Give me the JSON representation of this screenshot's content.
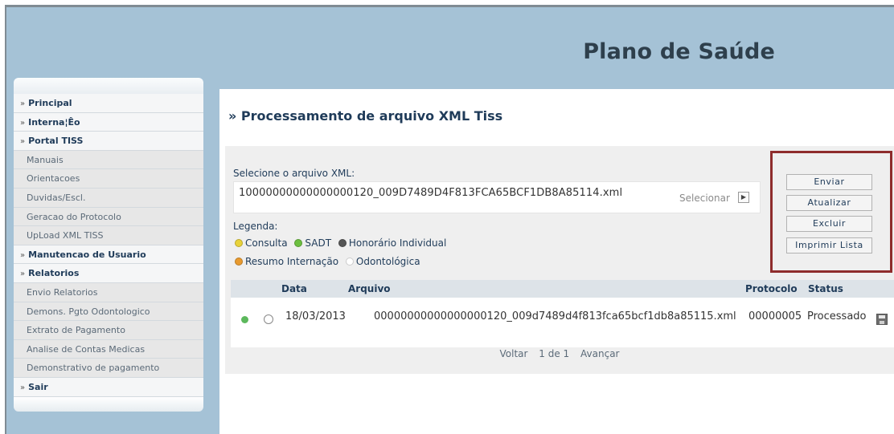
{
  "header": {
    "title": "Plano de Saúde"
  },
  "sidebar": {
    "items": [
      {
        "label": "Principal",
        "type": "main"
      },
      {
        "label": "Interna¦Êo",
        "type": "main"
      },
      {
        "label": "Portal TISS",
        "type": "main"
      },
      {
        "label": "Manuais",
        "type": "sub"
      },
      {
        "label": "Orientacoes",
        "type": "sub"
      },
      {
        "label": "Duvidas/Escl.",
        "type": "sub"
      },
      {
        "label": "Geracao do Protocolo",
        "type": "sub"
      },
      {
        "label": "UpLoad XML TISS",
        "type": "sub"
      },
      {
        "label": "Manutencao de Usuario",
        "type": "main"
      },
      {
        "label": "Relatorios",
        "type": "main"
      },
      {
        "label": "Envio Relatorios",
        "type": "sub"
      },
      {
        "label": "Demons. Pgto Odontologico",
        "type": "sub"
      },
      {
        "label": "Extrato de Pagamento",
        "type": "sub"
      },
      {
        "label": "Analise de Contas Medicas",
        "type": "sub"
      },
      {
        "label": "Demonstrativo de pagamento",
        "type": "sub"
      },
      {
        "label": "Sair",
        "type": "main"
      }
    ]
  },
  "main": {
    "page_title": "» Processamento de arquivo XML Tiss",
    "file": {
      "label": "Selecione o arquivo XML:",
      "value": "10000000000000000120_009D7489D4F813FCA65BCF1DB8A85114.xml",
      "select_label": "Selecionar"
    },
    "legend": {
      "label": "Legenda:",
      "items": [
        {
          "label": "Consulta",
          "color": "#e8d23a"
        },
        {
          "label": "SADT",
          "color": "#6cbf3f"
        },
        {
          "label": "Honorário Individual",
          "color": "#555555"
        },
        {
          "label": "Resumo Internação",
          "color": "#e89a2f"
        },
        {
          "label": "Odontológica",
          "color": "#ffffff"
        }
      ]
    },
    "actions": {
      "send": "Enviar",
      "refresh": "Atualizar",
      "delete": "Excluir",
      "print": "Imprimir Lista"
    },
    "table": {
      "headers": {
        "date": "Data",
        "file": "Arquivo",
        "protocol": "Protocolo",
        "status": "Status"
      },
      "rows": [
        {
          "status_color": "#5cb85c",
          "date": "18/03/2013",
          "file": "00000000000000000120_009d7489d4f813fca65bcf1db8a85115.xml",
          "protocol": "00000005",
          "status": "Processado"
        }
      ]
    },
    "pager": {
      "prev": "Voltar",
      "info": "1 de 1",
      "next": "Avançar"
    }
  }
}
